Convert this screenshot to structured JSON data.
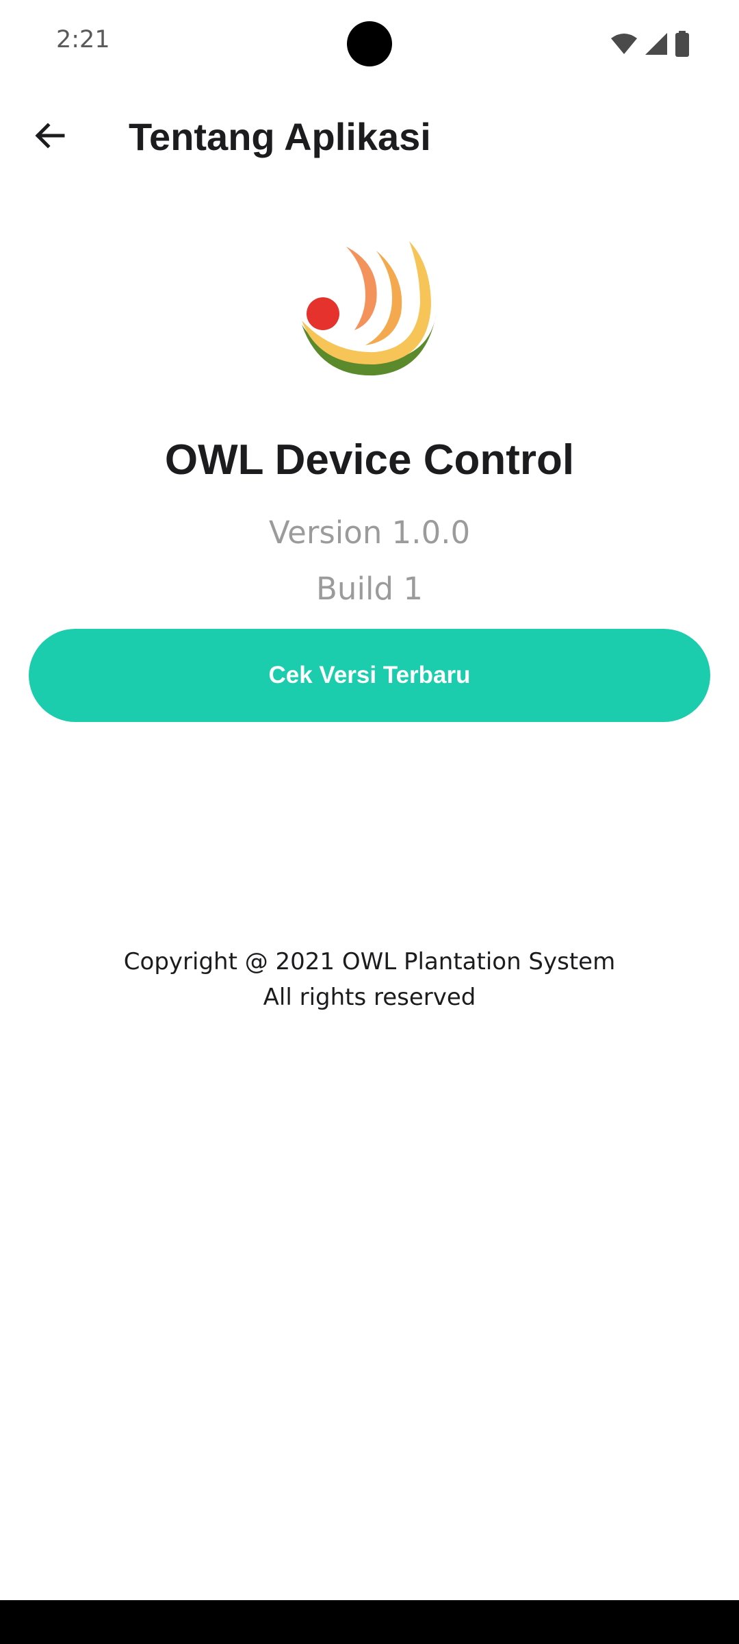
{
  "status_bar": {
    "time": "2:21",
    "icons": [
      "wifi-icon",
      "signal-icon",
      "battery-icon"
    ]
  },
  "app_bar": {
    "back_icon": "arrow-left-icon",
    "title": "Tentang Aplikasi"
  },
  "about": {
    "logo": "owl-logo",
    "app_name": "OWL Device Control",
    "version": "Version 1.0.0",
    "build": "Build 1",
    "check_button_label": "Cek Versi Terbaru",
    "copyright_line1": "Copyright @ 2021 OWL Plantation System",
    "copyright_line2": "All rights reserved"
  },
  "colors": {
    "accent": "#1ccdad",
    "title_text": "#1c1c1e",
    "muted_text": "#9b9b9b",
    "logo_red": "#e5322d",
    "logo_orange": "#f4925c",
    "logo_yellow": "#f6c457",
    "logo_green": "#5a8a2c"
  }
}
